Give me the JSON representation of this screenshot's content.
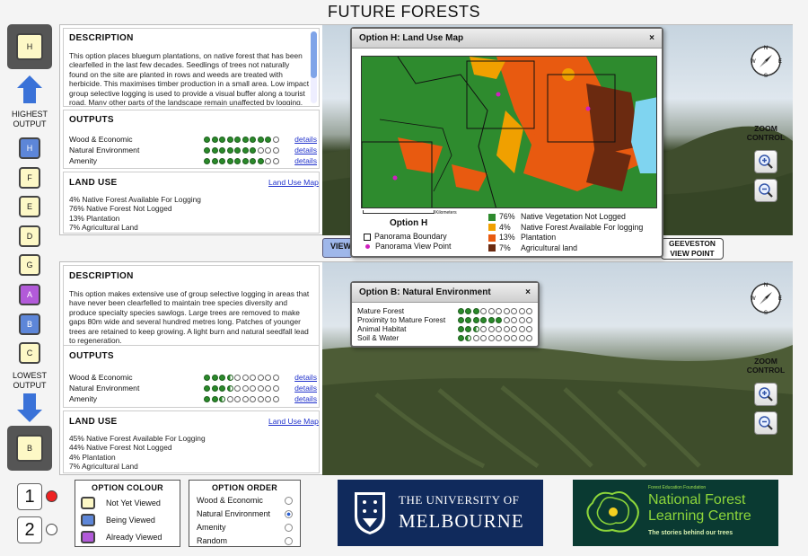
{
  "title": "FUTURE FORESTS",
  "current_option_top": "H",
  "current_option_bottom": "B",
  "order_labels": {
    "highest": "HIGHEST\nOUTPUT",
    "lowest": "LOWEST\nOUTPUT"
  },
  "option_column": [
    {
      "letter": "H",
      "state": "being_viewed"
    },
    {
      "letter": "F",
      "state": "not_yet_viewed"
    },
    {
      "letter": "E",
      "state": "not_yet_viewed"
    },
    {
      "letter": "D",
      "state": "not_yet_viewed"
    },
    {
      "letter": "G",
      "state": "not_yet_viewed"
    },
    {
      "letter": "A",
      "state": "already_viewed"
    },
    {
      "letter": "B",
      "state": "being_viewed"
    },
    {
      "letter": "C",
      "state": "not_yet_viewed"
    }
  ],
  "top_panel": {
    "description_heading": "DESCRIPTION",
    "description": "This option places bluegum plantations, on native forest that has been clearfelled in the last few decades. Seedlings of trees not naturally found on the site are planted in rows and weeds are treated with herbicide. This maximises timber production in a small area. Low impact group selective logging is used to provide a visual buffer along a tourist road. Many other parts of the landscape remain unaffected by logging.",
    "outputs_heading": "OUTPUTS",
    "outputs": [
      {
        "label": "Wood & Economic",
        "score": 9,
        "link": "details"
      },
      {
        "label": "Natural Environment",
        "score": 7,
        "link": "details"
      },
      {
        "label": "Amenity",
        "score": 8,
        "link": "details"
      }
    ],
    "land_use_heading": "LAND USE",
    "land_use_link": "Land Use Map",
    "land_use": [
      "4% Native Forest Available For Logging",
      "76% Native Forest Not Logged",
      "13% Plantation",
      "7% Agricultural Land"
    ],
    "view_button": "VIEW",
    "viewpoint_button": "GEEVESTON\nVIEW POINT"
  },
  "bottom_panel": {
    "description_heading": "DESCRIPTION",
    "description": "This option makes extensive use of group selective logging in areas that have never been clearfelled to maintain tree species diversity and produce specialty species sawlogs. Large trees are removed to make gaps 80m wide and several hundred metres long. Patches of younger trees are retained to keep growing. A light burn and natural seedfall lead to regeneration.",
    "outputs_heading": "OUTPUTS",
    "outputs": [
      {
        "label": "Wood & Economic",
        "score": 3.5,
        "link": "details"
      },
      {
        "label": "Natural Environment",
        "score": 3.5,
        "link": "details"
      },
      {
        "label": "Amenity",
        "score": 2.5,
        "link": "details"
      }
    ],
    "land_use_heading": "LAND USE",
    "land_use_link": "Land Use Map",
    "land_use": [
      "45% Native Forest Available For Logging",
      "44% Native Forest Not Logged",
      "4% Plantation",
      "7% Agricultural Land"
    ]
  },
  "zoom_label": "ZOOM\nCONTROL",
  "map_popup": {
    "title": "Option H: Land Use Map",
    "close": "×",
    "option_label": "Option H",
    "scale_label": "Kilometers",
    "legend_left": [
      "Panorama Boundary",
      "Panorama View Point"
    ],
    "legend": [
      {
        "pct": "76%",
        "label": "Native Vegetation Not Logged",
        "color": "#2e8b2e"
      },
      {
        "pct": "4%",
        "label": "Native Forest Available For logging",
        "color": "#f0a000"
      },
      {
        "pct": "13%",
        "label": "Plantation",
        "color": "#e85a10"
      },
      {
        "pct": "7%",
        "label": "Agricultural land",
        "color": "#6b2a10"
      }
    ]
  },
  "ne_popup": {
    "title": "Option B: Natural Environment",
    "close": "×",
    "rows": [
      {
        "label": "Mature Forest",
        "score": 3
      },
      {
        "label": "Proximity to Mature Forest",
        "score": 6
      },
      {
        "label": "Animal Habitat",
        "score": 2.5
      },
      {
        "label": "Soil & Water",
        "score": 1.5
      }
    ]
  },
  "screens": [
    {
      "num": "1",
      "active": true
    },
    {
      "num": "2",
      "active": false
    }
  ],
  "option_colour": {
    "heading": "OPTION COLOUR",
    "items": [
      {
        "label": "Not Yet Viewed",
        "color": "#fdf8c6"
      },
      {
        "label": "Being Viewed",
        "color": "#5d86d8"
      },
      {
        "label": "Already Viewed",
        "color": "#b25ad9"
      }
    ]
  },
  "option_order": {
    "heading": "OPTION ORDER",
    "items": [
      {
        "label": "Wood & Economic",
        "selected": false
      },
      {
        "label": "Natural Environment",
        "selected": true
      },
      {
        "label": "Amenity",
        "selected": false
      },
      {
        "label": "Random",
        "selected": false
      }
    ]
  },
  "logos": {
    "unimelb": {
      "line1": "THE UNIVERSITY OF",
      "line2": "MELBOURNE",
      "bg": "#102a5c"
    },
    "nflc": {
      "small": "Forest Education Foundation",
      "line1": "National Forest",
      "line2": "Learning Centre",
      "tag": "The stories behind our trees",
      "bg": "#0a3a32",
      "accent": "#8dd63a"
    }
  }
}
